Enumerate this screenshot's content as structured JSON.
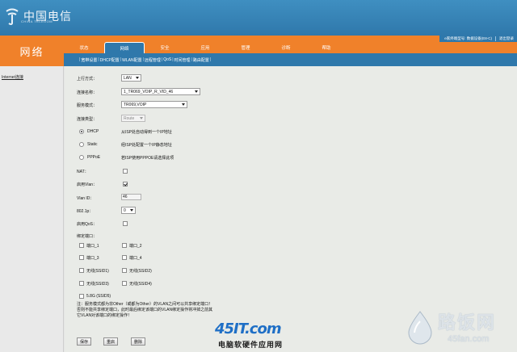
{
  "brand": {
    "logo_text": "中国电信",
    "logo_sub": "CHINA TELECOM"
  },
  "section_title": "网络",
  "device_info": {
    "model_label": "e家终端型号: 数据设备(E8-C)",
    "logout": "退出登录"
  },
  "tabs": [
    {
      "label": "状态",
      "active": false
    },
    {
      "label": "网络",
      "active": true
    },
    {
      "label": "安全",
      "active": false
    },
    {
      "label": "应用",
      "active": false
    },
    {
      "label": "管理",
      "active": false
    },
    {
      "label": "诊断",
      "active": false
    },
    {
      "label": "帮助",
      "active": false
    }
  ],
  "subnav": [
    "宽带设置",
    "DHCP配置",
    "WLAN配置",
    "远程管理",
    "QoS",
    "时间管理",
    "路由配置"
  ],
  "sidebar": {
    "link": "Internet连接"
  },
  "form": {
    "uplink_label": "上行方式：",
    "uplink_value": "LAN",
    "conn_name_label": "连接名称：",
    "conn_name_value": "1_TR069_VOIP_R_VID_46",
    "service_mode_label": "服务模式：",
    "service_mode_value": "TR069,VOIP",
    "conn_type_label": "连接类型：",
    "conn_type_value": "Route",
    "modes": [
      {
        "name": "DHCP",
        "desc": "从ISP处自动得到一个IP地址",
        "selected": true
      },
      {
        "name": "Static",
        "desc": "经ISP处配置一个IP静态地址",
        "selected": false
      },
      {
        "name": "PPPoE",
        "desc": "若ISP使用PPPOE请选择此项",
        "selected": false
      }
    ],
    "nat_label": "NAT：",
    "nat_checked": false,
    "vlan_enable_label": "启用Vlan：",
    "vlan_enable_checked": true,
    "vlan_id_label": "Vlan ID：",
    "vlan_id_value": "46",
    "p8021_label": "802.1p：",
    "p8021_value": "0",
    "qos_label": "启用QoS：",
    "qos_checked": false,
    "bind_ports_label": "绑定端口：",
    "ports": [
      {
        "label": "端口_1",
        "checked": false
      },
      {
        "label": "端口_2",
        "checked": false
      },
      {
        "label": "端口_3",
        "checked": false
      },
      {
        "label": "端口_4",
        "checked": false
      },
      {
        "label": "无线(SSID1)",
        "checked": false
      },
      {
        "label": "无线(SSID2)",
        "checked": false
      },
      {
        "label": "无线(SSID3)",
        "checked": false
      },
      {
        "label": "无线(SSID4)",
        "checked": false
      },
      {
        "label": "5.8G (SSID5)",
        "checked": false
      }
    ]
  },
  "note": {
    "line1": "注：服务模式都为非Other（或都为Other）的VLAN之间可以共享绑定端口！",
    "line2": "否则不能共享绑定端口，此时最后绑定该端口的VLAN绑定操作将冲掉之前其",
    "line3": "它VLAN对该端口的绑定操作！"
  },
  "buttons": {
    "save": "保存",
    "reset": "重启",
    "delete": "删除"
  },
  "watermarks": {
    "site1_top": "45IT.com",
    "site1_bottom": "电脑软硬件应用网",
    "site2_name": "路饭网",
    "site2_url": "45fan.com"
  },
  "colors": {
    "orange": "#f0812a",
    "blue": "#2f78ab",
    "content_bg": "#e9ebe7"
  }
}
